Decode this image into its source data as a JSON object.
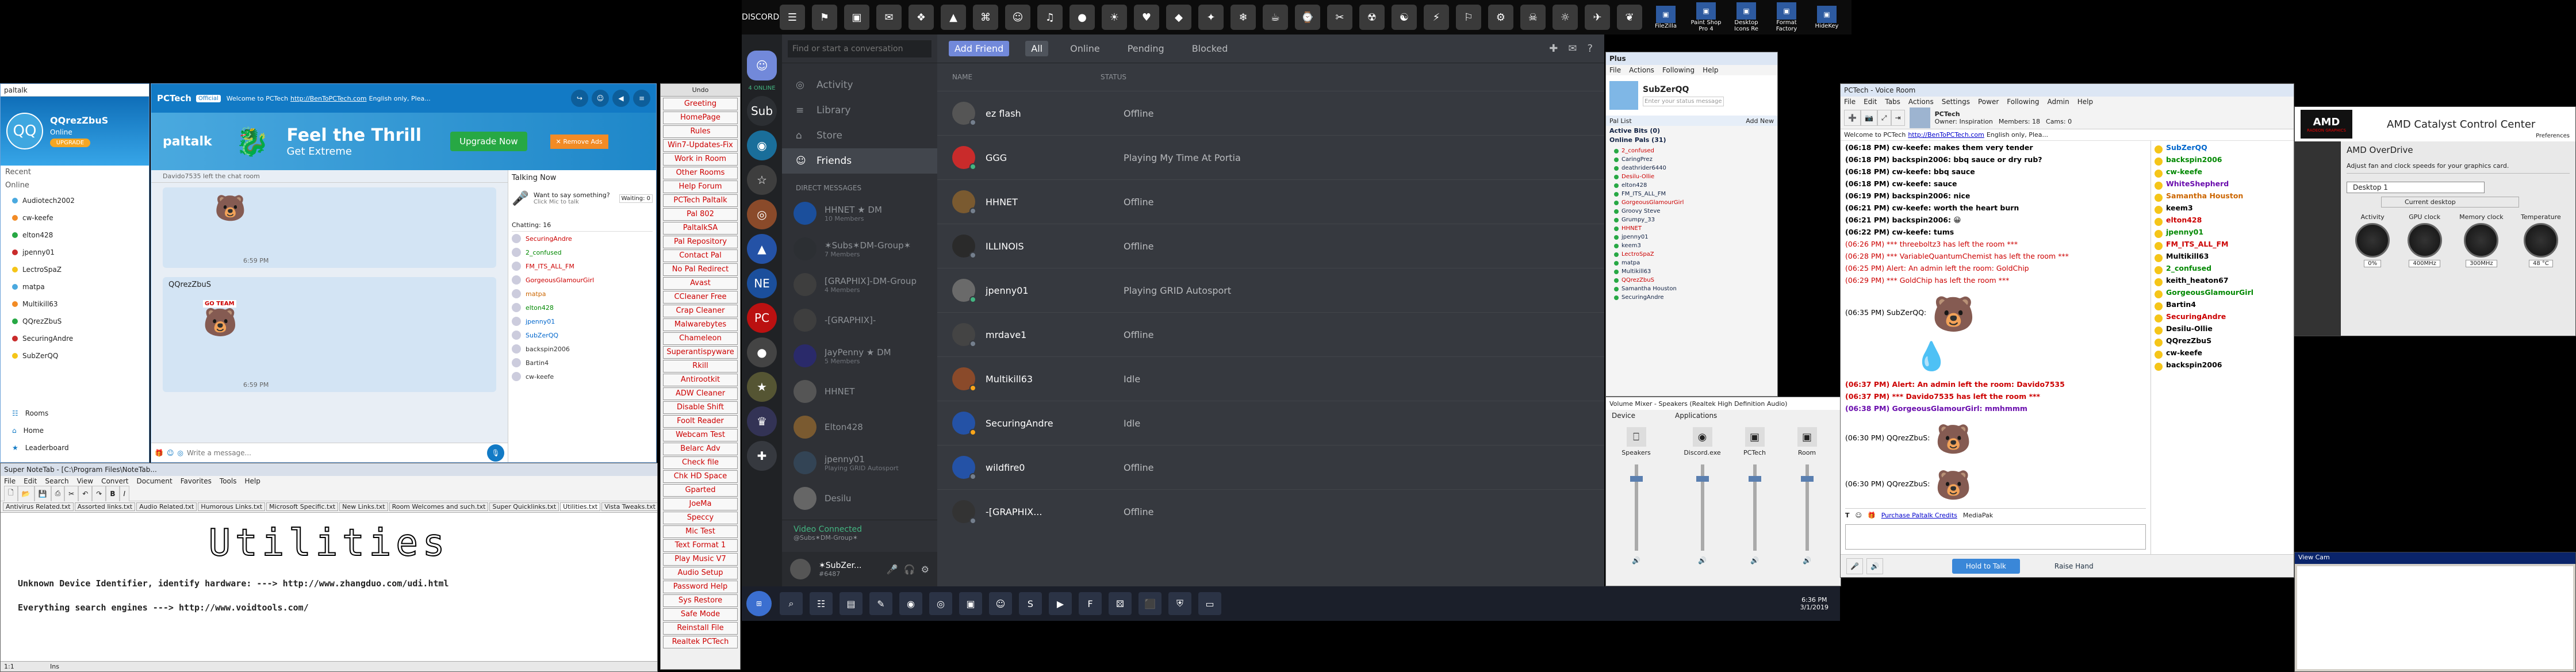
{
  "colors": {
    "discord_bg": "#36393f",
    "discord_accent": "#7289da",
    "online": "#43b581",
    "idle": "#faa61a",
    "offline": "#747f8d",
    "paltalk_blue": "#127ac5",
    "red_text": "#cc0000"
  },
  "paltalk": {
    "title": "paltalk",
    "username": "QQrezZbuS",
    "status": "Online",
    "avatar_initials": "QQ",
    "upgrade": "UPGRADE",
    "recent_label": "Recent",
    "online_label": "Online",
    "contacts": [
      "Audiotech2002",
      "cw-keefe",
      "elton428",
      "jpenny01",
      "LectroSpaZ",
      "matpa",
      "Multikill63",
      "QQrezZbuS",
      "SecuringAndre",
      "SubZerQQ"
    ],
    "nav": [
      "Rooms",
      "Home",
      "Leaderboard"
    ]
  },
  "room": {
    "title": "PCTech",
    "badge": "Official",
    "welcome": "Welcome to PCTech",
    "url": "http://BenToPCTech.com",
    "welcome_tail": "English only, Plea...",
    "banner_title": "Feel the Thrill",
    "banner_sub": "Get Extreme",
    "upgrade_btn": "Upgrade Now",
    "remove_ads": "✕ Remove Ads",
    "left_notice": "Davido7535 left the chat room",
    "sender": "QQrezZbuS",
    "time1": "6:59 PM",
    "time2": "6:59 PM",
    "sticker_text": "GO TEAM",
    "placeholder": "Write a message...",
    "talking_now": "Talking Now",
    "want_speak": "Want to say something?",
    "click_talk": "Click Mic to talk",
    "waiting": "Waiting: 0",
    "chatting": "Chatting: 16",
    "users": [
      "SecuringAndre",
      "2_confused",
      "FM_ITS_ALL_FM",
      "GorgeousGlamourGirl",
      "matpa",
      "elton428",
      "jpenny01",
      "SubZerQQ",
      "backspin2006",
      "Bartin4",
      "cw-keefe"
    ]
  },
  "side": {
    "title": "Undo",
    "buttons": [
      "Greeting",
      "HomePage",
      "Rules",
      "Win7-Updates-Fix",
      "Work in Room",
      "Other Rooms",
      "Help Forum",
      "PCTech Paltalk",
      "Pal 802",
      "PaltalkSA",
      "Pal Repository",
      "Contact Pal",
      "No Pal Redirect",
      "Avast",
      "CCleaner Free",
      "Crap Cleaner",
      "Malwarebytes",
      "Chameleon",
      "Superantispyware",
      "Rkill",
      "Antirootkit",
      "ADW Cleaner",
      "Disable Shift",
      "Foolt Reader",
      "Webcam Test",
      "Belarc Adv",
      "Check file",
      "Chk HD Space",
      "Gparted",
      "JoeMa",
      "Speccy",
      "Mic Test",
      "Text Format 1",
      "Play Music V7",
      "Audio Setup",
      "Password Help",
      "Sys Restore",
      "Safe Mode",
      "Reinstall File",
      "Realtek PCTech"
    ]
  },
  "note": {
    "title": "Super NoteTab - [C:\\Program Files\\NoteTab...",
    "menu": [
      "File",
      "Edit",
      "Search",
      "View",
      "Convert",
      "Document",
      "Favorites",
      "Tools",
      "Help"
    ],
    "tabs": [
      "Antivirus Related.txt",
      "Assorted links.txt",
      "Audio Related.txt",
      "Humorous Links.txt",
      "Microsoft Specific.txt",
      "New Links.txt",
      "Room Welcomes and such.txt",
      "Super Quicklinks.txt",
      "Utilities.txt",
      "Vista Tweaks.txt"
    ],
    "banner": "Utilities",
    "line1_label": "Unknown Device Identifier, identify hardware: --->",
    "line1_url": "http://www.zhangduo.com/udi.html",
    "line2_label": "Everything search engines --->",
    "line2_url": "http://www.voidtools.com/",
    "status_pos": "1:1",
    "status_mode": "Ins"
  },
  "topbar": {
    "labels": [
      "FileZilla",
      "Paint Shop Pro 4",
      "Desktop Icons Re",
      "Format Factory",
      "HideKey",
      "Super NoteTab"
    ]
  },
  "discord": {
    "brand": "DISCORD",
    "search_placeholder": "Find or start a conversation",
    "online_count": "4 ONLINE",
    "nav": [
      "Activity",
      "Library",
      "Store",
      "Friends"
    ],
    "dm_header": "DIRECT MESSAGES",
    "dms": [
      {
        "name": "HHNET ★ DM",
        "sub": "10 Members"
      },
      {
        "name": "✶Subs✶DM-Group✶",
        "sub": "7 Members"
      },
      {
        "name": "[GRAPHIX]-DM-Group",
        "sub": "4 Members"
      },
      {
        "name": "-[GRAPHIX]-",
        "sub": ""
      },
      {
        "name": "JayPenny ★ DM",
        "sub": "5 Members"
      },
      {
        "name": "HHNET",
        "sub": ""
      },
      {
        "name": "Elton428",
        "sub": ""
      },
      {
        "name": "jpenny01",
        "sub": "Playing GRID Autosport"
      },
      {
        "name": "Desilu",
        "sub": ""
      }
    ],
    "voice_connected": "Video Connected",
    "voice_sub": "@Subs✶DM-Group✶",
    "me_name": "✶SubZer...",
    "me_tag": "#6487",
    "tabs": [
      "Add Friend",
      "All",
      "Online",
      "Pending",
      "Blocked"
    ],
    "col_name": "NAME",
    "col_status": "STATUS",
    "friends": [
      {
        "name": "ez flash",
        "status": "Offline",
        "state": "offline"
      },
      {
        "name": "GGG",
        "status": "Playing My Time At Portia",
        "state": "online"
      },
      {
        "name": "HHNET",
        "status": "Offline",
        "state": "offline"
      },
      {
        "name": "ILLINOIS",
        "status": "Offline",
        "state": "offline"
      },
      {
        "name": "jpenny01",
        "status": "Playing GRID Autosport",
        "state": "online"
      },
      {
        "name": "mrdave1",
        "status": "Offline",
        "state": "offline"
      },
      {
        "name": "Multikill63",
        "status": "Idle",
        "state": "idle"
      },
      {
        "name": "SecuringAndre",
        "status": "Idle",
        "state": "idle"
      },
      {
        "name": "wildfire0",
        "status": "Offline",
        "state": "offline"
      },
      {
        "name": "-[GRAPHIX...",
        "status": "Offline",
        "state": "offline"
      }
    ]
  },
  "plus": {
    "title": "Plus",
    "menu": [
      "File",
      "Actions",
      "Following",
      "Help"
    ],
    "user": "SubZerQQ",
    "status_ph": "Enter your status message",
    "list_title": "Pal List",
    "add_new": "Add New",
    "groups": [
      {
        "label": "Active Bits (0)"
      },
      {
        "label": "Online Pals (31)"
      }
    ],
    "pals": [
      "2_confused",
      "CaringPrez",
      "deathrider6440",
      "Desilu-Ollie",
      "elton428",
      "FM_ITS_ALL_FM",
      "GorgeousGlamourGirl",
      "Groovy Steve",
      "Grumpy_33",
      "HHNET",
      "jpenny01",
      "keem3",
      "LectroSpaZ",
      "matpa",
      "Multikill63",
      "QQrezZbuS",
      "Samantha Houston",
      "SecuringAndre"
    ]
  },
  "mixer": {
    "title": "Volume Mixer - Speakers (Realtek High Definition Audio)",
    "device": "Device",
    "apps": "Applications",
    "channels": [
      "Speakers",
      "Discord.exe",
      "PCTech",
      "Room"
    ]
  },
  "voice": {
    "title": "PCTech - Voice Room",
    "menu": [
      "File",
      "Edit",
      "Tabs",
      "Actions",
      "Settings",
      "Power",
      "Following",
      "Admin",
      "Help"
    ],
    "room": "PCTech",
    "owner": "Owner: Inspiration",
    "members": "Members: 18",
    "cams": "Cams: 0",
    "lines": [
      {
        "t": "(06:18 PM) cw-keefe: makes them very tender",
        "c": "#000"
      },
      {
        "t": "(06:18 PM) backspin2006: bbq sauce or dry rub?",
        "c": "#000"
      },
      {
        "t": "(06:18 PM) cw-keefe: bbq sauce",
        "c": "#000"
      },
      {
        "t": "(06:18 PM) cw-keefe: sauce",
        "c": "#000"
      },
      {
        "t": "(06:19 PM) backspin2006: nice",
        "c": "#000"
      },
      {
        "t": "(06:21 PM) cw-keefe: worth the heart burn",
        "c": "#000"
      },
      {
        "t": "(06:21 PM) backspin2006: 😀",
        "c": "#000"
      },
      {
        "t": "(06:22 PM) cw-keefe: tums",
        "c": "#000"
      },
      {
        "t": "(06:26 PM) *** threeboltz3 has left the room ***",
        "c": "#c00"
      },
      {
        "t": "(06:28 PM) *** VariableQuantumChemist has left the room ***",
        "c": "#c00"
      },
      {
        "t": "(06:25 PM) Alert: An admin left the room: GoldChip",
        "c": "#c00"
      },
      {
        "t": "(06:29 PM) *** GoldChip has left the room ***",
        "c": "#c00"
      }
    ],
    "lines2": [
      {
        "t": "(06:37 PM) Alert: An admin left the room: Davido7535",
        "c": "#c00"
      },
      {
        "t": "(06:37 PM) *** Davido7535 has left the room ***",
        "c": "#c00"
      },
      {
        "t": "(06:38 PM) GorgeousGlamourGirl: mmhmmm",
        "c": "#6a0dad"
      }
    ],
    "sub1": "(06:35 PM) SubZerQQ:",
    "sub2": "(06:30 PM) QQrezZbuS:",
    "sub3": "(06:30 PM) QQrezZbuS:",
    "users": [
      "SubZerQQ",
      "backspin2006",
      "cw-keefe",
      "WhiteShepherd",
      "Samantha Houston",
      "keem3",
      "elton428",
      "jpenny01",
      "FM_ITS_ALL_FM",
      "Multikill63",
      "2_confused",
      "keith_heaton67",
      "GorgeousGlamourGirl",
      "Bartin4",
      "SecuringAndre",
      "Desilu-Ollie",
      "QQrezZbuS",
      "cw-keefe",
      "backspin2006"
    ],
    "footer_link": "Purchase Paltalk Credits",
    "media": "MediaPak",
    "hold": "Hold to Talk",
    "raise": "Raise Hand"
  },
  "amd": {
    "title": "AMD Catalyst Control Center",
    "brand": "AMD",
    "sub": "RADEON GRAPHICS",
    "preferences": "Preferences",
    "section": "AMD OverDrive",
    "desc": "Adjust fan and clock speeds for your graphics card.",
    "desktop": "Desktop 1",
    "current": "Current desktop",
    "gauges": [
      {
        "label": "Activity",
        "value": "0%"
      },
      {
        "label": "GPU clock",
        "value": "400MHz"
      },
      {
        "label": "Memory clock",
        "value": "300MHz"
      },
      {
        "label": "Temperature",
        "value": "48 °C"
      }
    ]
  },
  "cam": {
    "title": "View Cam"
  },
  "taskbar": {
    "time": "6:36 PM",
    "date": "3/1/2019"
  }
}
